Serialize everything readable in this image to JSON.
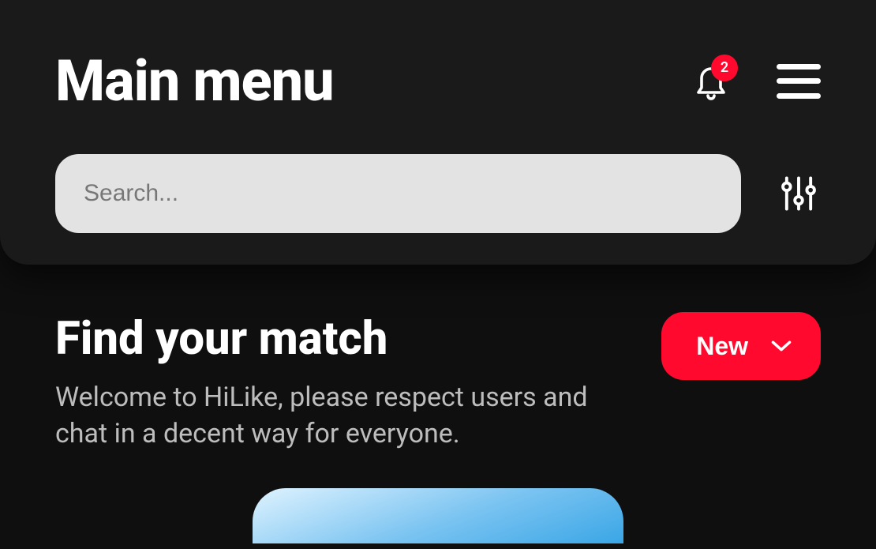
{
  "header": {
    "title": "Main menu",
    "notification_count": "2"
  },
  "search": {
    "placeholder": "Search..."
  },
  "section": {
    "title": "Find your match",
    "subtitle": "Welcome to HiLike, please respect users and chat in a decent way for everyone.",
    "filter_button_label": "New"
  }
}
